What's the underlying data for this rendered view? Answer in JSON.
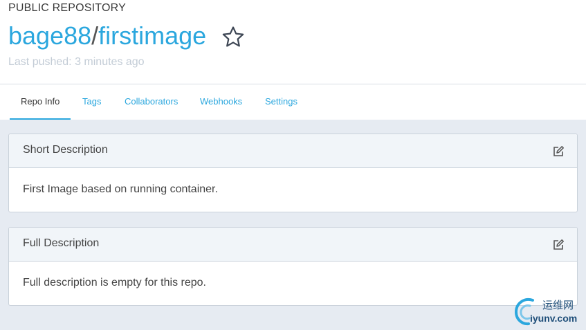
{
  "repo": {
    "type_label": "PUBLIC REPOSITORY",
    "owner": "bage88",
    "separator": "/",
    "name": "firstimage",
    "last_pushed": "Last pushed: 3 minutes ago",
    "star_icon": "star-outline-icon"
  },
  "tabs": [
    {
      "label": "Repo Info",
      "active": true
    },
    {
      "label": "Tags",
      "active": false
    },
    {
      "label": "Collaborators",
      "active": false
    },
    {
      "label": "Webhooks",
      "active": false
    },
    {
      "label": "Settings",
      "active": false
    }
  ],
  "panels": {
    "short": {
      "title": "Short Description",
      "body": "First Image based on running container.",
      "edit_icon": "edit-icon"
    },
    "full": {
      "title": "Full Description",
      "body": "Full description is empty for this repo.",
      "edit_icon": "edit-icon"
    }
  },
  "watermark": {
    "cn": "运维网",
    "en": "iyunv.com"
  },
  "colors": {
    "accent": "#2ba7de",
    "muted": "#c3ccd6",
    "panel_bg": "#e6ebf2",
    "panel_head": "#f1f5f9"
  }
}
